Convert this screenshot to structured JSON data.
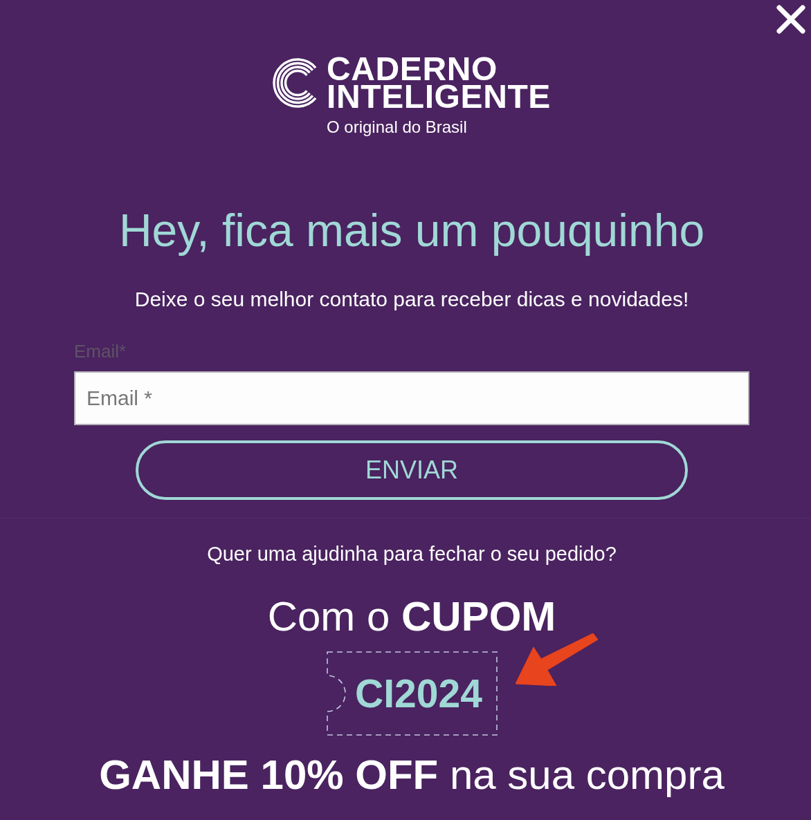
{
  "logo": {
    "wordmark": [
      "CADERNO",
      "INTELIGENTE"
    ],
    "tagline": "O original do Brasil"
  },
  "heading": "Hey, fica mais um pouquinho",
  "subtitle": "Deixe o seu melhor contato para receber dicas e novidades!",
  "form": {
    "label": "Email*",
    "placeholder": "Email *",
    "submit": "ENVIAR"
  },
  "promo": {
    "question": "Quer uma ajudinha para fechar o seu pedido?",
    "headline": "Com o **CUPOM**",
    "coupon_code": "CI2024",
    "offer": "**GANHE 10% OFF** na sua compra"
  }
}
